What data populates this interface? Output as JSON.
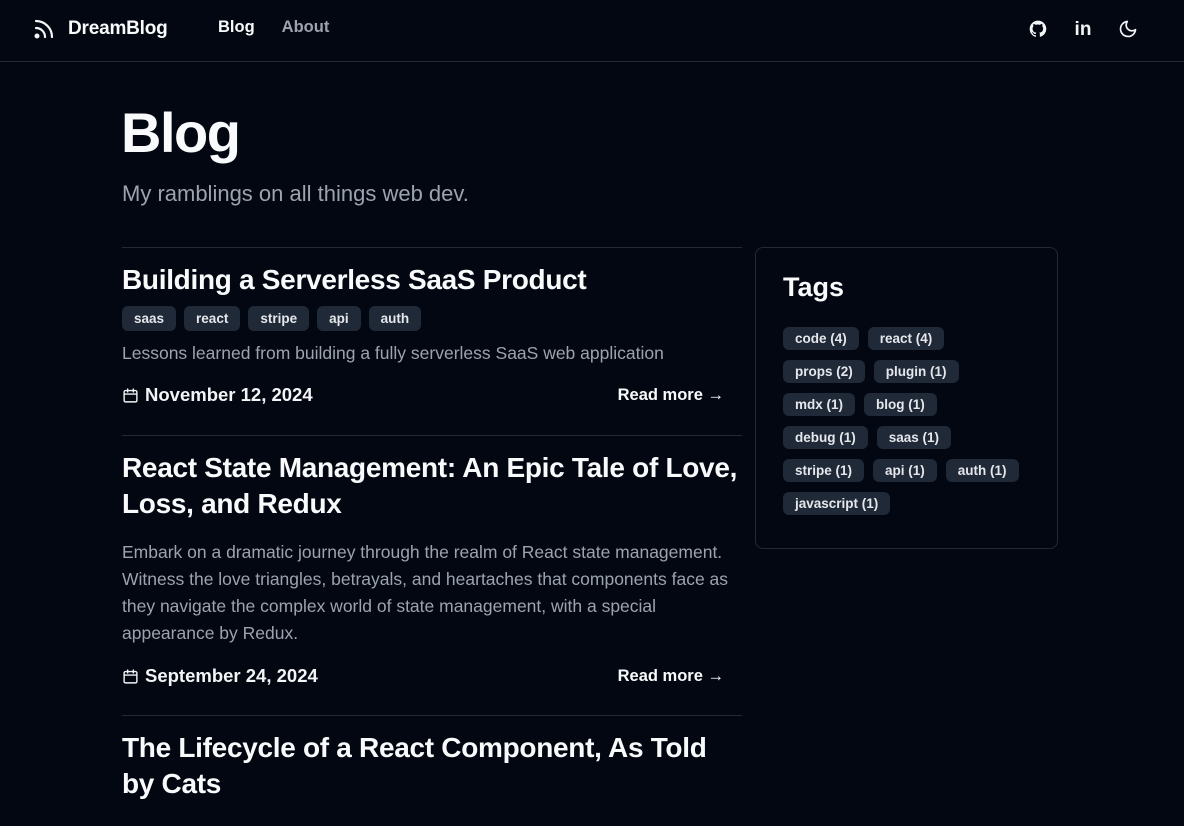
{
  "header": {
    "brand": "DreamBlog",
    "nav": [
      {
        "label": "Blog"
      },
      {
        "label": "About"
      }
    ],
    "icons": [
      "github-icon",
      "linkedin-icon",
      "moon-icon"
    ],
    "linkedin_text": "in"
  },
  "page": {
    "title": "Blog",
    "subtitle": "My ramblings on all things web dev."
  },
  "posts": [
    {
      "title": "Building a Serverless SaaS Product",
      "tags": [
        "saas",
        "react",
        "stripe",
        "api",
        "auth"
      ],
      "summary": "Lessons learned from building a fully serverless SaaS web application",
      "date": "November 12, 2024",
      "read_more": "Read more →"
    },
    {
      "title": "React State Management: An Epic Tale of Love, Loss, and Redux",
      "tags": [],
      "summary": "Embark on a dramatic journey through the realm of React state management. Witness the love triangles, betrayals, and heartaches that components face as they navigate the complex world of state management, with a special appearance by Redux.",
      "date": "September 24, 2024",
      "read_more": "Read more →"
    },
    {
      "title": "The Lifecycle of a React Component, As Told by Cats",
      "tags": [],
      "summary": "",
      "date": "",
      "read_more": ""
    }
  ],
  "sidebar": {
    "title": "Tags",
    "tags": [
      "code (4)",
      "react (4)",
      "props (2)",
      "plugin (1)",
      "mdx (1)",
      "blog (1)",
      "debug (1)",
      "saas (1)",
      "stripe (1)",
      "api (1)",
      "auth (1)",
      "javascript (1)"
    ]
  },
  "colors": {
    "background": "#030712",
    "chip": "#1f2937",
    "muted_text": "#9ca3af",
    "border": "#1f2937"
  }
}
